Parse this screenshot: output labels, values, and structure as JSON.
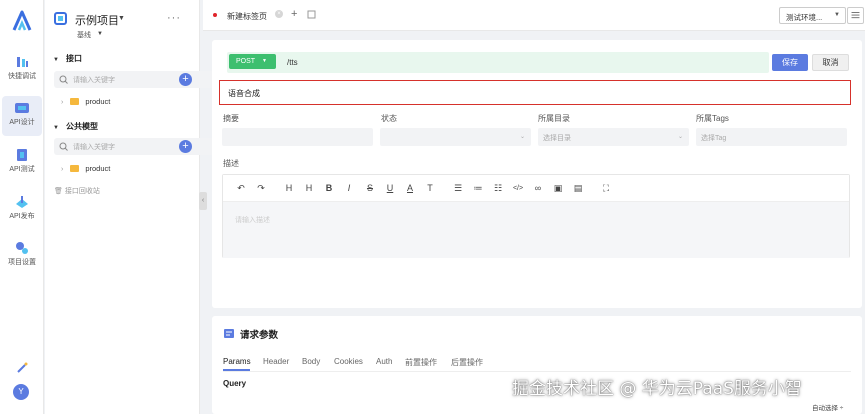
{
  "rail": {
    "items": [
      {
        "label": "快捷调试",
        "icon": "debug-icon"
      },
      {
        "label": "API设计",
        "icon": "api-design-icon",
        "active": true
      },
      {
        "label": "API测试",
        "icon": "api-test-icon"
      },
      {
        "label": "API发布",
        "icon": "api-publish-icon"
      },
      {
        "label": "项目设置",
        "icon": "project-settings-icon"
      }
    ],
    "avatar": "Y"
  },
  "sidebar": {
    "project_name": "示例项目",
    "branch": "基线",
    "more": "···",
    "sections": [
      {
        "title": "接口",
        "search_placeholder": "请输入关键字",
        "items": [
          {
            "label": "product"
          }
        ]
      },
      {
        "title": "公共模型",
        "search_placeholder": "请输入关键字",
        "items": [
          {
            "label": "product"
          }
        ]
      }
    ],
    "recycle_label": "接口回收站"
  },
  "tabs": {
    "items": [
      {
        "label": "新建标签页",
        "unsaved": true
      }
    ],
    "add": "+",
    "env_label": "测试环境..."
  },
  "editor": {
    "method": "POST",
    "url": "/tts",
    "save_label": "保存",
    "cancel_label": "取消",
    "name_value": "语音合成",
    "fields": {
      "summary_label": "摘要",
      "status_label": "状态",
      "directory_label": "所属目录",
      "directory_placeholder": "选择目录",
      "tags_label": "所属Tags",
      "tags_placeholder": "选择Tag"
    },
    "description_label": "描述",
    "description_placeholder": "请输入描述",
    "toolbar": [
      "undo-icon",
      "redo-icon",
      "heading-icon",
      "heading-alt-icon",
      "bold-icon",
      "italic-icon",
      "strikethrough-icon",
      "underline-icon",
      "font-color-icon",
      "font-size-icon",
      "bullet-list-icon",
      "ordered-list-icon",
      "task-list-icon",
      "code-icon",
      "link-icon",
      "image-icon",
      "table-icon",
      "fullscreen-icon"
    ]
  },
  "params": {
    "title": "请求参数",
    "tabs": [
      "Params",
      "Header",
      "Body",
      "Cookies",
      "Auth",
      "前置操作",
      "后置操作"
    ],
    "active_tab": "Params",
    "query_label": "Query"
  },
  "watermark": "掘金技术社区 @ 华为云PaaS服务小智",
  "auto_select": "自动选择 ÷",
  "colors": {
    "accent": "#5b7be0",
    "method": "#3dbf6f",
    "highlight_border": "#d6312b"
  }
}
